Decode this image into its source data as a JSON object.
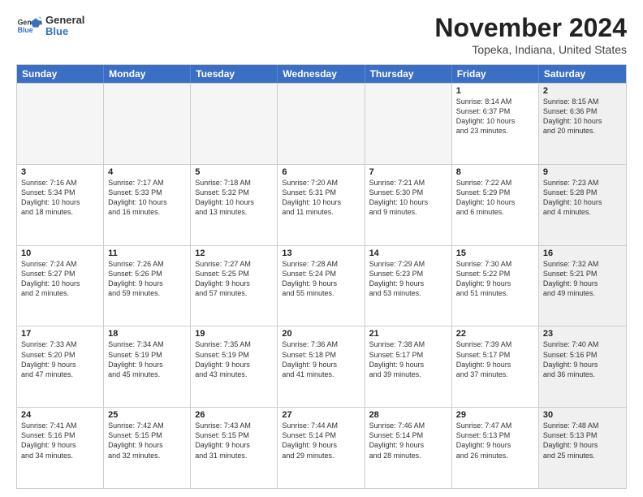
{
  "logo": {
    "line1": "General",
    "line2": "Blue"
  },
  "title": "November 2024",
  "location": "Topeka, Indiana, United States",
  "days": [
    "Sunday",
    "Monday",
    "Tuesday",
    "Wednesday",
    "Thursday",
    "Friday",
    "Saturday"
  ],
  "rows": [
    [
      {
        "day": "",
        "info": "",
        "empty": true
      },
      {
        "day": "",
        "info": "",
        "empty": true
      },
      {
        "day": "",
        "info": "",
        "empty": true
      },
      {
        "day": "",
        "info": "",
        "empty": true
      },
      {
        "day": "",
        "info": "",
        "empty": true
      },
      {
        "day": "1",
        "info": "Sunrise: 8:14 AM\nSunset: 6:37 PM\nDaylight: 10 hours\nand 23 minutes.",
        "empty": false,
        "shaded": false
      },
      {
        "day": "2",
        "info": "Sunrise: 8:15 AM\nSunset: 6:36 PM\nDaylight: 10 hours\nand 20 minutes.",
        "empty": false,
        "shaded": true
      }
    ],
    [
      {
        "day": "3",
        "info": "Sunrise: 7:16 AM\nSunset: 5:34 PM\nDaylight: 10 hours\nand 18 minutes.",
        "empty": false,
        "shaded": false
      },
      {
        "day": "4",
        "info": "Sunrise: 7:17 AM\nSunset: 5:33 PM\nDaylight: 10 hours\nand 16 minutes.",
        "empty": false,
        "shaded": false
      },
      {
        "day": "5",
        "info": "Sunrise: 7:18 AM\nSunset: 5:32 PM\nDaylight: 10 hours\nand 13 minutes.",
        "empty": false,
        "shaded": false
      },
      {
        "day": "6",
        "info": "Sunrise: 7:20 AM\nSunset: 5:31 PM\nDaylight: 10 hours\nand 11 minutes.",
        "empty": false,
        "shaded": false
      },
      {
        "day": "7",
        "info": "Sunrise: 7:21 AM\nSunset: 5:30 PM\nDaylight: 10 hours\nand 9 minutes.",
        "empty": false,
        "shaded": false
      },
      {
        "day": "8",
        "info": "Sunrise: 7:22 AM\nSunset: 5:29 PM\nDaylight: 10 hours\nand 6 minutes.",
        "empty": false,
        "shaded": false
      },
      {
        "day": "9",
        "info": "Sunrise: 7:23 AM\nSunset: 5:28 PM\nDaylight: 10 hours\nand 4 minutes.",
        "empty": false,
        "shaded": true
      }
    ],
    [
      {
        "day": "10",
        "info": "Sunrise: 7:24 AM\nSunset: 5:27 PM\nDaylight: 10 hours\nand 2 minutes.",
        "empty": false,
        "shaded": false
      },
      {
        "day": "11",
        "info": "Sunrise: 7:26 AM\nSunset: 5:26 PM\nDaylight: 9 hours\nand 59 minutes.",
        "empty": false,
        "shaded": false
      },
      {
        "day": "12",
        "info": "Sunrise: 7:27 AM\nSunset: 5:25 PM\nDaylight: 9 hours\nand 57 minutes.",
        "empty": false,
        "shaded": false
      },
      {
        "day": "13",
        "info": "Sunrise: 7:28 AM\nSunset: 5:24 PM\nDaylight: 9 hours\nand 55 minutes.",
        "empty": false,
        "shaded": false
      },
      {
        "day": "14",
        "info": "Sunrise: 7:29 AM\nSunset: 5:23 PM\nDaylight: 9 hours\nand 53 minutes.",
        "empty": false,
        "shaded": false
      },
      {
        "day": "15",
        "info": "Sunrise: 7:30 AM\nSunset: 5:22 PM\nDaylight: 9 hours\nand 51 minutes.",
        "empty": false,
        "shaded": false
      },
      {
        "day": "16",
        "info": "Sunrise: 7:32 AM\nSunset: 5:21 PM\nDaylight: 9 hours\nand 49 minutes.",
        "empty": false,
        "shaded": true
      }
    ],
    [
      {
        "day": "17",
        "info": "Sunrise: 7:33 AM\nSunset: 5:20 PM\nDaylight: 9 hours\nand 47 minutes.",
        "empty": false,
        "shaded": false
      },
      {
        "day": "18",
        "info": "Sunrise: 7:34 AM\nSunset: 5:19 PM\nDaylight: 9 hours\nand 45 minutes.",
        "empty": false,
        "shaded": false
      },
      {
        "day": "19",
        "info": "Sunrise: 7:35 AM\nSunset: 5:19 PM\nDaylight: 9 hours\nand 43 minutes.",
        "empty": false,
        "shaded": false
      },
      {
        "day": "20",
        "info": "Sunrise: 7:36 AM\nSunset: 5:18 PM\nDaylight: 9 hours\nand 41 minutes.",
        "empty": false,
        "shaded": false
      },
      {
        "day": "21",
        "info": "Sunrise: 7:38 AM\nSunset: 5:17 PM\nDaylight: 9 hours\nand 39 minutes.",
        "empty": false,
        "shaded": false
      },
      {
        "day": "22",
        "info": "Sunrise: 7:39 AM\nSunset: 5:17 PM\nDaylight: 9 hours\nand 37 minutes.",
        "empty": false,
        "shaded": false
      },
      {
        "day": "23",
        "info": "Sunrise: 7:40 AM\nSunset: 5:16 PM\nDaylight: 9 hours\nand 36 minutes.",
        "empty": false,
        "shaded": true
      }
    ],
    [
      {
        "day": "24",
        "info": "Sunrise: 7:41 AM\nSunset: 5:16 PM\nDaylight: 9 hours\nand 34 minutes.",
        "empty": false,
        "shaded": false
      },
      {
        "day": "25",
        "info": "Sunrise: 7:42 AM\nSunset: 5:15 PM\nDaylight: 9 hours\nand 32 minutes.",
        "empty": false,
        "shaded": false
      },
      {
        "day": "26",
        "info": "Sunrise: 7:43 AM\nSunset: 5:15 PM\nDaylight: 9 hours\nand 31 minutes.",
        "empty": false,
        "shaded": false
      },
      {
        "day": "27",
        "info": "Sunrise: 7:44 AM\nSunset: 5:14 PM\nDaylight: 9 hours\nand 29 minutes.",
        "empty": false,
        "shaded": false
      },
      {
        "day": "28",
        "info": "Sunrise: 7:46 AM\nSunset: 5:14 PM\nDaylight: 9 hours\nand 28 minutes.",
        "empty": false,
        "shaded": false
      },
      {
        "day": "29",
        "info": "Sunrise: 7:47 AM\nSunset: 5:13 PM\nDaylight: 9 hours\nand 26 minutes.",
        "empty": false,
        "shaded": false
      },
      {
        "day": "30",
        "info": "Sunrise: 7:48 AM\nSunset: 5:13 PM\nDaylight: 9 hours\nand 25 minutes.",
        "empty": false,
        "shaded": true
      }
    ]
  ]
}
